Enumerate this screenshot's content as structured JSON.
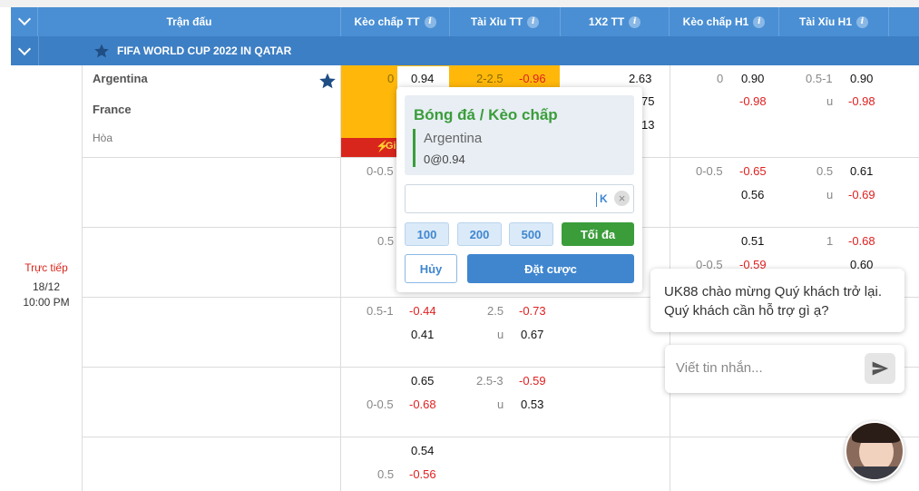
{
  "header": {
    "col_match": "Trận đấu",
    "col_hdp_ft": "Kèo chấp TT",
    "col_ou_ft": "Tài Xỉu TT",
    "col_1x2_ft": "1X2 TT",
    "col_hdp_h1": "Kèo chấp H1",
    "col_ou_h1": "Tài Xỉu H1",
    "info_glyph": "i"
  },
  "league": {
    "name": "FIFA WORLD CUP 2022 IN QATAR"
  },
  "match": {
    "status": "Trực tiếp",
    "date": "18/12",
    "time": "10:00 PM",
    "home": "Argentina",
    "away": "France",
    "draw": "Hòa",
    "promo": "Gi"
  },
  "rows": [
    {
      "hdp_line": "0",
      "hdp_home": "0.94",
      "ou_line": "2-2.5",
      "ou_over": "-0.96",
      "x1": "2.63",
      "x2": "75",
      "x3": "13",
      "h1_line": "0",
      "h1_home": "0.90",
      "h1_away": "-0.98",
      "h1ou_line": "0.5-1",
      "h1ou_u": "u",
      "h1ou_over": "0.90",
      "h1ou_under": "-0.98"
    },
    {
      "hdp_line": "0-0.5",
      "h1_line": "0-0.5",
      "h1_home": "-0.65",
      "h1_away": "0.56",
      "h1ou_line": "0.5",
      "h1ou_u": "u",
      "h1ou_over": "0.61",
      "h1ou_under": "-0.69"
    },
    {
      "hdp_line": "0.5",
      "h1_line": "0-0.5",
      "h1_home": "0.51",
      "h1_away": "-0.59",
      "h1ou_line": "1",
      "h1ou_over": "-0.68",
      "h1ou_under": "0.60"
    },
    {
      "hdp_line": "0.5-1",
      "hdp_home": "-0.44",
      "hdp_away": "0.41",
      "ou_line": "2.5",
      "ou_u": "u",
      "ou_over": "-0.73",
      "ou_under": "0.67"
    },
    {
      "hdp_home": "0.65",
      "hdp_line": "0-0.5",
      "hdp_away": "-0.68",
      "ou_line": "2.5-3",
      "ou_u": "u",
      "ou_over": "-0.59",
      "ou_under": "0.53"
    },
    {
      "hdp_home": "0.54",
      "hdp_line": "0.5",
      "hdp_away": "-0.56"
    }
  ],
  "betslip": {
    "title": "Bóng đá / Kèo chấp",
    "team": "Argentina",
    "odds": "0@0.94",
    "stake_value": "",
    "stake_suffix": "K",
    "clear": "×",
    "quick": [
      "100",
      "200",
      "500"
    ],
    "max": "Tối đa",
    "cancel": "Hủy",
    "place": "Đặt cược"
  },
  "chat": {
    "greeting": "UK88 chào mừng Quý khách trở lại. Quý khách cần hỗ trợ gì ạ?",
    "placeholder": "Viết tin nhắn..."
  },
  "colors": {
    "header": "#4a8fd4",
    "league": "#3d7fc4",
    "highlight": "#ffb80a",
    "promo": "#d9261c",
    "green": "#3a9d3a",
    "blue": "#3f86cf",
    "negative": "#e02020"
  }
}
